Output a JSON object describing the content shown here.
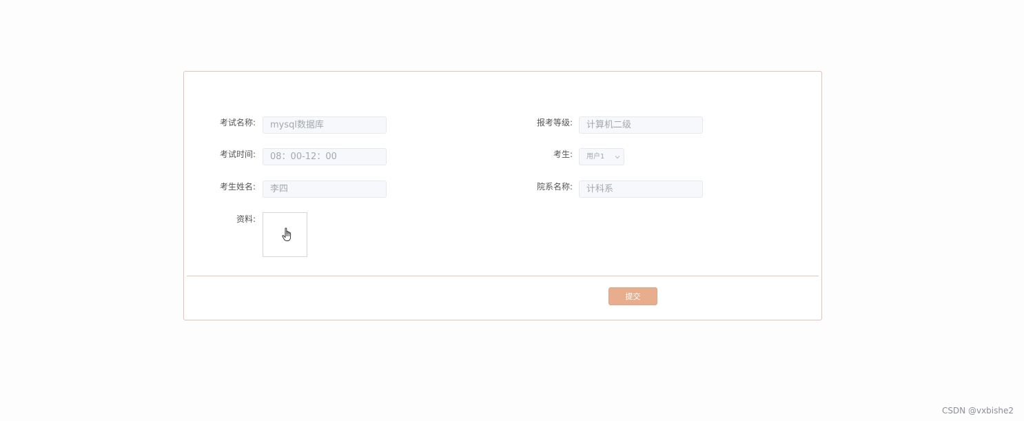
{
  "form": {
    "exam_name": {
      "label": "考试名称:",
      "value": "mysql数据库"
    },
    "exam_level": {
      "label": "报考等级:",
      "value": "计算机二级"
    },
    "exam_time": {
      "label": "考试时间:",
      "value": "08：00-12：00"
    },
    "examinee": {
      "label": "考生:",
      "value": "用户1"
    },
    "student_name": {
      "label": "考生姓名:",
      "value": "李四"
    },
    "department": {
      "label": "院系名称:",
      "value": "计科系"
    },
    "material": {
      "label": "资料:"
    }
  },
  "actions": {
    "submit_label": "提交"
  },
  "watermark": "CSDN @vxbishe2",
  "colors": {
    "accent": "#e8ad8d",
    "border": "#e3c4b8"
  }
}
